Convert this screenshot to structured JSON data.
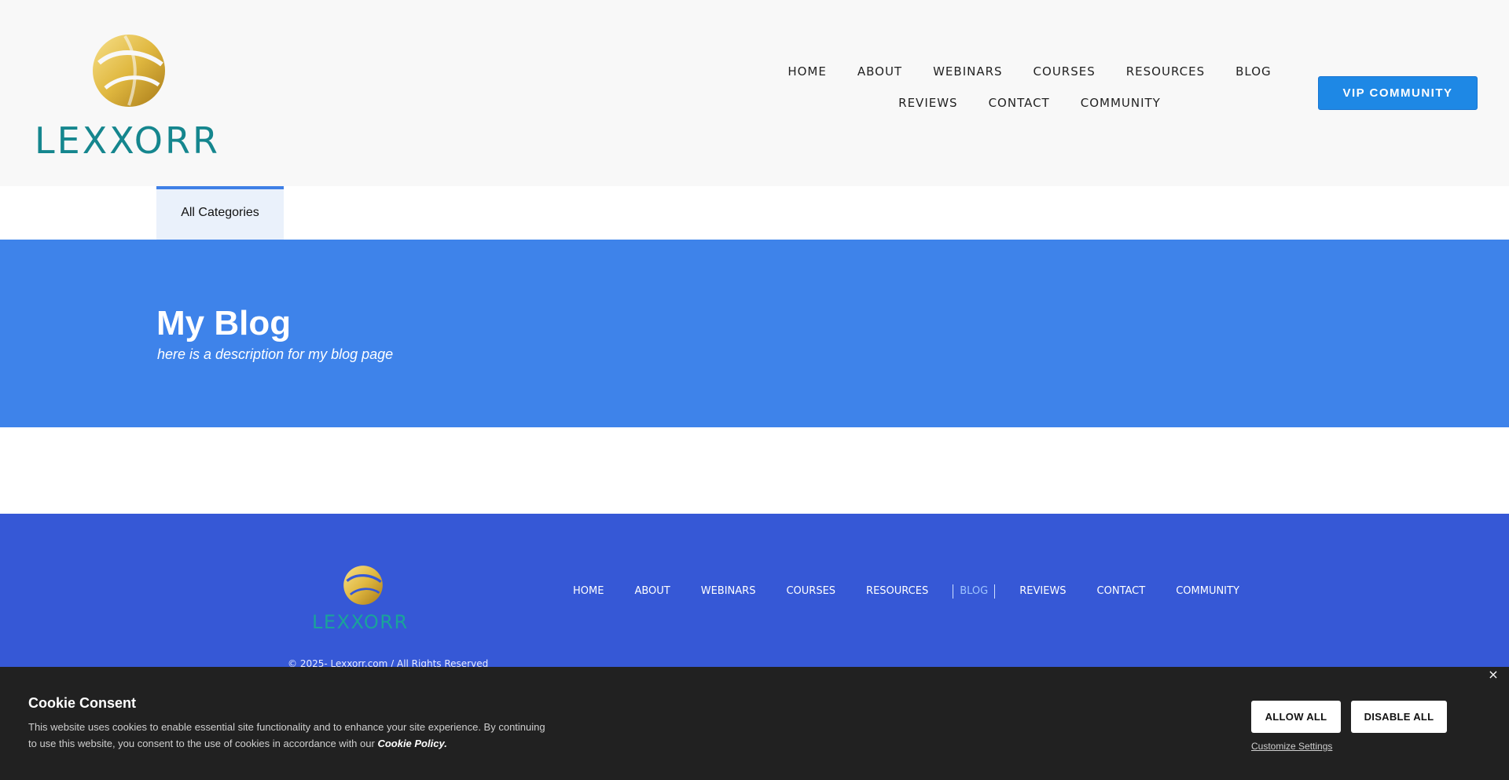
{
  "header": {
    "logo_text": "LEXXORR",
    "nav_row1": [
      "HOME",
      "ABOUT",
      "WEBINARS",
      "COURSES",
      "RESOURCES",
      "BLOG"
    ],
    "nav_row2": [
      "REVIEWS",
      "CONTACT",
      "COMMUNITY"
    ],
    "cta_label": "VIP COMMUNITY"
  },
  "tabs": {
    "active_label": "All Categories"
  },
  "hero": {
    "title": "My Blog",
    "description": "here is a description for my blog page"
  },
  "footer": {
    "logo_text": "LEXXORR",
    "nav": [
      "HOME",
      "ABOUT",
      "WEBINARS",
      "COURSES",
      "RESOURCES",
      "BLOG",
      "REVIEWS",
      "CONTACT",
      "COMMUNITY"
    ],
    "active_nav": "BLOG",
    "copyright": "© 2025- Lexxorr.com  / All Rights Reserved"
  },
  "cookie": {
    "title": "Cookie Consent",
    "text_line1": "This website uses cookies to enable essential site functionality and to enhance your site experience. By continuing",
    "text_line2": "to use this website, you consent to the use of cookies in accordance with our",
    "policy_link": "Cookie Policy.",
    "allow_label": "ALLOW ALL",
    "disable_label": "DISABLE ALL",
    "customize_label": "Customize Settings",
    "close_glyph": "×"
  },
  "colors": {
    "header_bg": "#f8f8f8",
    "accent": "#1e88e5",
    "hero_bg": "#3e83ea",
    "footer_bg": "#3658d6",
    "cookie_bg": "#212121",
    "logo_teal": "#15868e",
    "logo_gold": "#e0b840"
  }
}
